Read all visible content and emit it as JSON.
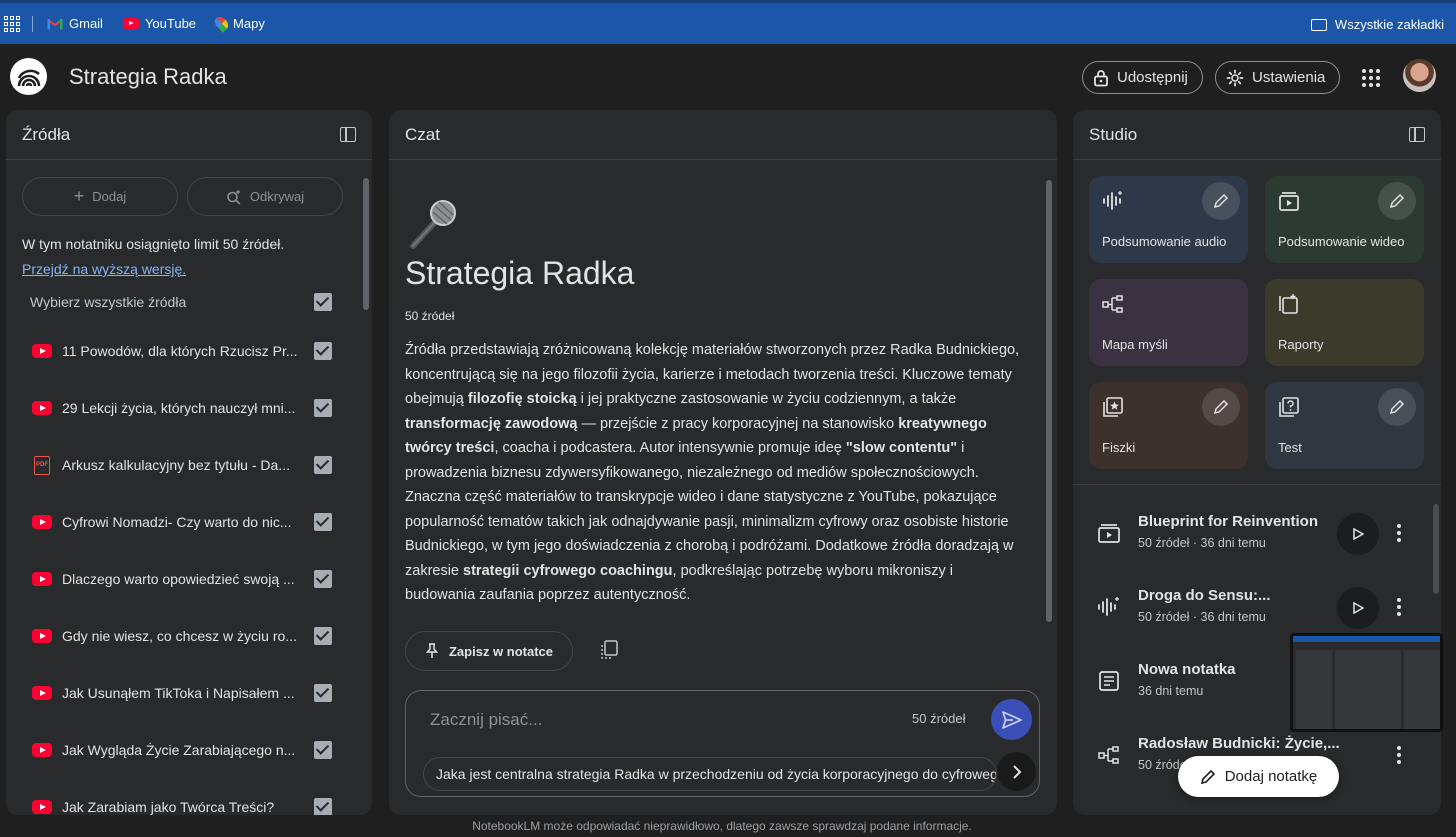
{
  "bookmarks": {
    "items": [
      {
        "label": "Gmail",
        "icon": "gmail-icon"
      },
      {
        "label": "YouTube",
        "icon": "youtube-icon"
      },
      {
        "label": "Mapy",
        "icon": "maps-icon"
      }
    ],
    "all_bookmarks": "Wszystkie zakładki"
  },
  "header": {
    "title": "Strategia Radka",
    "share_label": "Udostępnij",
    "settings_label": "Ustawienia"
  },
  "sources": {
    "title": "Źródła",
    "add_label": "Dodaj",
    "discover_label": "Odkrywaj",
    "limit_text": "W tym notatniku osiągnięto limit 50 źródeł.",
    "upgrade_link": "Przejdź na wyższą wersję.",
    "select_all": "Wybierz wszystkie źródła",
    "items": [
      {
        "label": "11 Powodów, dla których Rzucisz Pr...",
        "type": "youtube"
      },
      {
        "label": "29 Lekcji życia, których nauczył mni...",
        "type": "youtube"
      },
      {
        "label": "Arkusz kalkulacyjny bez tytułu - Da...",
        "type": "pdf"
      },
      {
        "label": "Cyfrowi Nomadzi- Czy warto do nic...",
        "type": "youtube"
      },
      {
        "label": "Dlaczego warto opowiedzieć swoją ...",
        "type": "youtube"
      },
      {
        "label": "Gdy nie wiesz, co chcesz w życiu ro...",
        "type": "youtube"
      },
      {
        "label": "Jak Usunąłem TikToka i Napisałem ...",
        "type": "youtube"
      },
      {
        "label": "Jak Wygląda Życie Zarabiającego n...",
        "type": "youtube"
      },
      {
        "label": "Jak Zarabiam jako Twórca Treści?",
        "type": "youtube"
      }
    ]
  },
  "chat": {
    "title": "Czat",
    "notebook_title": "Strategia Radka",
    "source_count": "50 źródeł",
    "summary": [
      {
        "t": "Źródła przedstawiają zróżnicowaną kolekcję materiałów stworzonych przez Radka Budnickiego, koncentrującą się na jego filozofii życia, karierze i metodach tworzenia treści. Kluczowe tematy obejmują ",
        "b": false
      },
      {
        "t": "filozofię stoicką",
        "b": true
      },
      {
        "t": " i jej praktyczne zastosowanie w życiu codziennym, a także ",
        "b": false
      },
      {
        "t": "transformację zawodową",
        "b": true
      },
      {
        "t": " — przejście z pracy korporacyjnej na stanowisko ",
        "b": false
      },
      {
        "t": "kreatywnego twórcy treści",
        "b": true
      },
      {
        "t": ", coacha i podcastera. Autor intensywnie promuje ideę ",
        "b": false
      },
      {
        "t": "\"slow contentu\"",
        "b": true
      },
      {
        "t": " i prowadzenia biznesu zdywersyfikowanego, niezależnego od mediów społecznościowych. Znaczna część materiałów to transkrypcje wideo i dane statystyczne z YouTube, pokazujące popularność tematów takich jak odnajdywanie pasji, minimalizm cyfrowy oraz osobiste historie Budnickiego, w tym jego doświadczenia z chorobą i podróżami. Dodatkowe źródła doradzają w zakresie ",
        "b": false
      },
      {
        "t": "strategii cyfrowego coachingu",
        "b": true
      },
      {
        "t": ", podkreślając potrzebę wyboru mikroniszy i budowania zaufania poprzez autentyczność.",
        "b": false
      }
    ],
    "save_note_label": "Zapisz w notatce",
    "input_placeholder": "Zacznij pisać...",
    "input_source_count": "50 źródeł",
    "suggestion": "Jaka jest centralna strategia Radka w przechodzeniu od życia korporacyjnego do cyfrowego"
  },
  "studio": {
    "title": "Studio",
    "tiles": [
      {
        "label": "Podsumowanie audio",
        "icon": "audio-wave-icon",
        "color": "#2f3a4a"
      },
      {
        "label": "Podsumowanie wideo",
        "icon": "video-icon",
        "color": "#2c3a30"
      },
      {
        "label": "Mapa myśli",
        "icon": "mind-map-icon",
        "color": "#3a3140"
      },
      {
        "label": "Raporty",
        "icon": "report-icon",
        "color": "#3b3b2c"
      },
      {
        "label": "Fiszki",
        "icon": "flashcards-icon",
        "color": "#3d3230"
      },
      {
        "label": "Test",
        "icon": "quiz-icon",
        "color": "#2f3740"
      }
    ],
    "notes": [
      {
        "title": "Blueprint for Reinvention",
        "sub": "50 źródeł · 36 dni temu",
        "icon": "video-icon"
      },
      {
        "title": "Droga do Sensu:...",
        "sub": "50 źródeł · 36 dni temu",
        "icon": "audio-wave-icon"
      },
      {
        "title": "Nowa notatka",
        "sub": "36 dni temu",
        "icon": "note-icon"
      },
      {
        "title": "Radosław Budnicki: Życie,...",
        "sub": "50 źródeł",
        "icon": "mind-map-icon"
      }
    ],
    "add_note_label": "Dodaj notatkę"
  },
  "footer": "NotebookLM może odpowiadać nieprawidłowo, dlatego zawsze sprawdzaj podane informacje."
}
